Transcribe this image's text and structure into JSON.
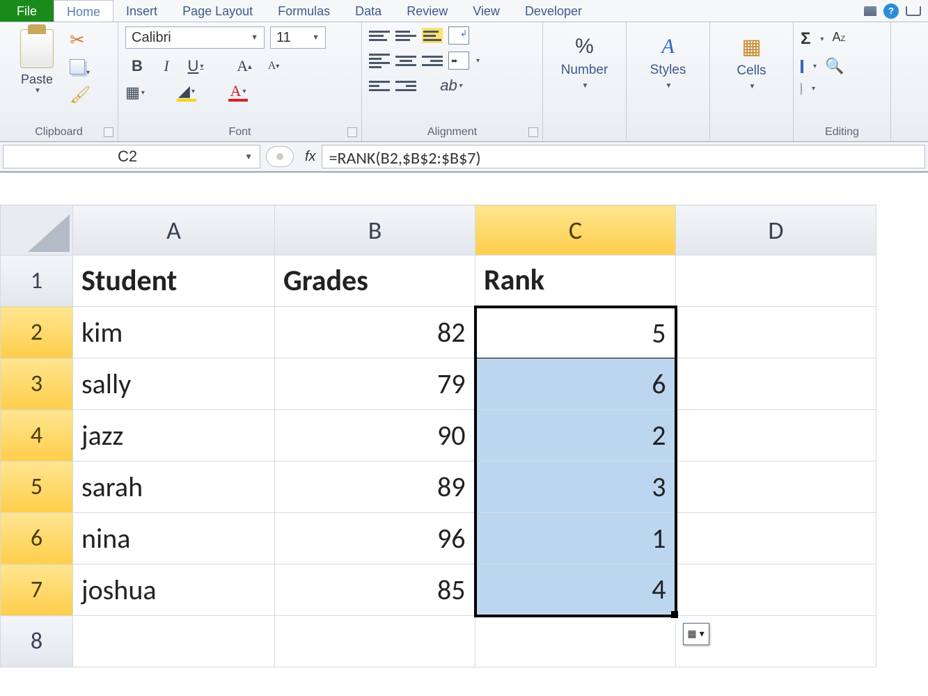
{
  "tabs": {
    "file": "File",
    "items": [
      "Home",
      "Insert",
      "Page Layout",
      "Formulas",
      "Data",
      "Review",
      "View",
      "Developer"
    ],
    "active": "Home"
  },
  "ribbon": {
    "clipboard": {
      "label": "Clipboard",
      "paste": "Paste"
    },
    "font": {
      "label": "Font",
      "name": "Calibri",
      "size": "11",
      "bold": "B",
      "italic": "I",
      "underline": "U"
    },
    "alignment": {
      "label": "Alignment"
    },
    "number": {
      "label": "Number",
      "symbol": "%"
    },
    "styles": {
      "label": "Styles"
    },
    "cells": {
      "label": "Cells"
    },
    "editing": {
      "label": "Editing"
    }
  },
  "formula_bar": {
    "name_box": "C2",
    "fx": "fx",
    "formula": "=RANK(B2,$B$2:$B$7)"
  },
  "grid": {
    "columns": [
      "A",
      "B",
      "C",
      "D"
    ],
    "active_column": "C",
    "row_headers": [
      "1",
      "2",
      "3",
      "4",
      "5",
      "6",
      "7",
      "8"
    ],
    "selected_rows": [
      "2",
      "3",
      "4",
      "5",
      "6",
      "7"
    ],
    "headers": {
      "A": "Student",
      "B": "Grades",
      "C": "Rank"
    },
    "rows": [
      {
        "r": "2",
        "A": "kim",
        "B": "82",
        "C": "5"
      },
      {
        "r": "3",
        "A": "sally",
        "B": "79",
        "C": "6"
      },
      {
        "r": "4",
        "A": "jazz",
        "B": "90",
        "C": "2"
      },
      {
        "r": "5",
        "A": "sarah",
        "B": "89",
        "C": "3"
      },
      {
        "r": "6",
        "A": "nina",
        "B": "96",
        "C": "1"
      },
      {
        "r": "7",
        "A": "joshua",
        "B": "85",
        "C": "4"
      }
    ],
    "active_cell": "C2",
    "selection": "C2:C7"
  }
}
